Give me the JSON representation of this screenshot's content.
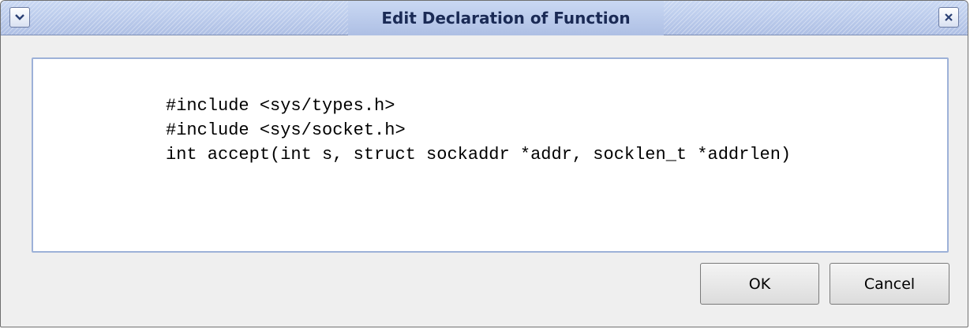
{
  "window": {
    "title": "Edit Declaration of Function",
    "menu_icon": "chevron-down-icon",
    "close_icon": "close-icon"
  },
  "editor": {
    "lines": [
      "#include <sys/types.h>",
      "#include <sys/socket.h>",
      "int accept(int s, struct sockaddr *addr, socklen_t *addrlen)"
    ]
  },
  "buttons": {
    "ok_label": "OK",
    "cancel_label": "Cancel"
  },
  "colors": {
    "titlebar": "#b8c8ea",
    "title_text": "#1a2a55",
    "dialog_bg": "#efefef",
    "editor_border": "#9db1d8"
  }
}
